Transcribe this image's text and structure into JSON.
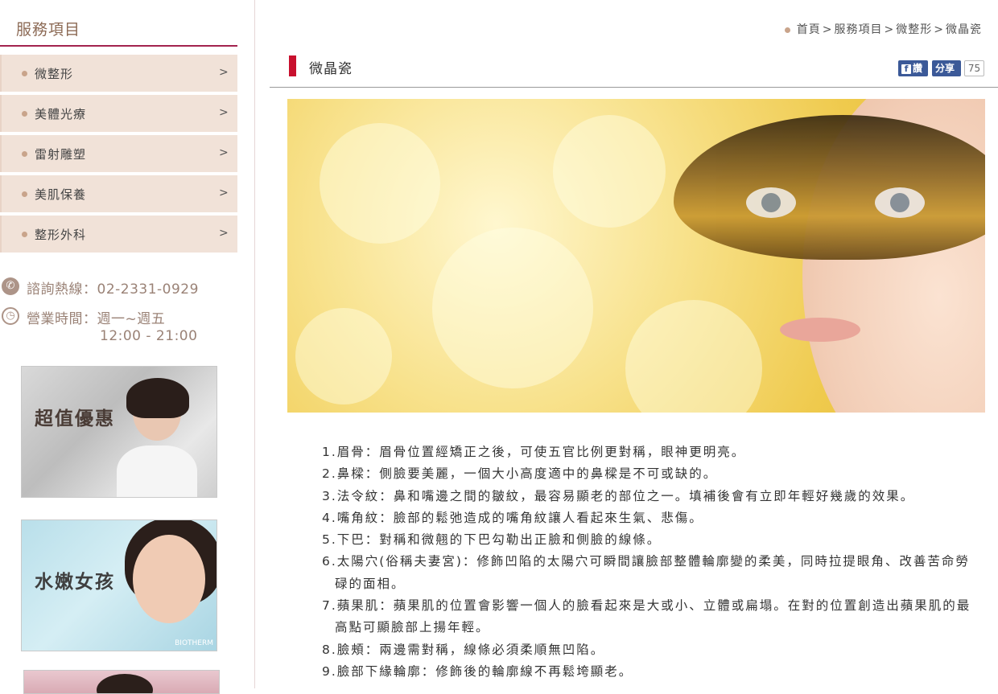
{
  "sidebar": {
    "title": "服務項目",
    "menu": [
      {
        "label": "微整形",
        "arrow": ">"
      },
      {
        "label": "美體光療",
        "arrow": ">"
      },
      {
        "label": "雷射雕塑",
        "arrow": ">"
      },
      {
        "label": "美肌保養",
        "arrow": ">"
      },
      {
        "label": "整形外科",
        "arrow": ">"
      }
    ],
    "hotline": "諮詢熱線：02-2331-0929",
    "hours_line1": "營業時間：週一~週五",
    "hours_line2": "12:00 - 21:00",
    "banners": [
      {
        "text": "超值優惠"
      },
      {
        "text": "水嫩女孩",
        "brand": "BIOTHERM"
      }
    ]
  },
  "breadcrumb": {
    "home": "首頁",
    "sep": ">",
    "level1": "服務項目",
    "level2": "微整形",
    "current": "微晶瓷"
  },
  "page": {
    "title": "微晶瓷",
    "fb_like": "讚",
    "fb_share": "分享",
    "fb_count": "75"
  },
  "content": {
    "items": [
      "1.眉骨：眉骨位置經矯正之後，可使五官比例更對稱，眼神更明亮。",
      "2.鼻樑：側臉要美麗，一個大小高度適中的鼻樑是不可或缺的。",
      "3.法令紋：鼻和嘴邊之間的皺紋，最容易顯老的部位之一。填補後會有立即年輕好幾歲的效果。",
      "4.嘴角紋：臉部的鬆弛造成的嘴角紋讓人看起來生氣、悲傷。",
      "5.下巴：對稱和微翹的下巴勾勒出正臉和側臉的線條。",
      "6.太陽穴(俗稱夫妻宮)：修飾凹陷的太陽穴可瞬間讓臉部整體輪廓變的柔美，同時拉提眼角、改善苦命勞碌的面相。",
      "7.蘋果肌：蘋果肌的位置會影響一個人的臉看起來是大或小、立體或扁塌。在對的位置創造出蘋果肌的最高點可顯臉部上揚年輕。",
      "8.臉頰：兩邊需對稱，線條必須柔順無凹陷。",
      "9.臉部下緣輪廓：修飾後的輪廓線不再鬆垮顯老。"
    ]
  },
  "colors": {
    "accent": "#a3234e",
    "title_bar": "#c8102e",
    "menu_bg": "#f1e2d8",
    "facebook": "#3b5998"
  },
  "icons": {
    "phone": "phone-icon",
    "clock": "clock-icon",
    "facebook": "facebook-icon"
  }
}
